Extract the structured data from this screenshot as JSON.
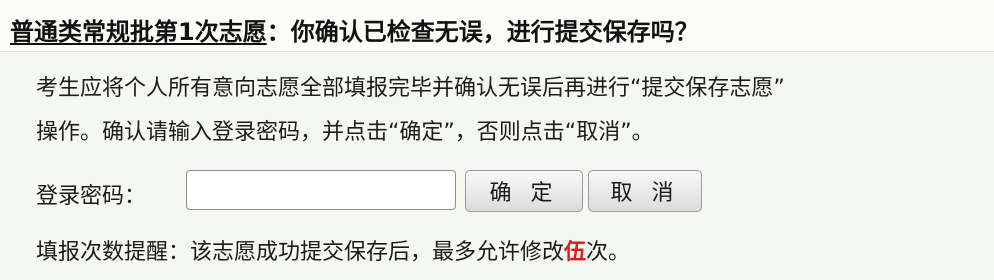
{
  "dialog": {
    "title_link": "普通类常规批第1次志愿",
    "title_question": "：你确认已检查无误，进行提交保存吗？",
    "instruction_line1": "考生应将个人所有意向志愿全部填报完毕并确认无误后再进行“提交保存志愿”",
    "instruction_line2": "操作。确认请输入登录密码，并点击“确定”，否则点击“取消”。",
    "password_label": "登录密码：",
    "password_value": "",
    "confirm_button": "确 定",
    "cancel_button": "取 消",
    "reminder_prefix": "填报次数提醒：该志愿成功提交保存后，最多允许修改",
    "reminder_count": "伍",
    "reminder_suffix": "次。",
    "highlight_color": "#e01818"
  }
}
